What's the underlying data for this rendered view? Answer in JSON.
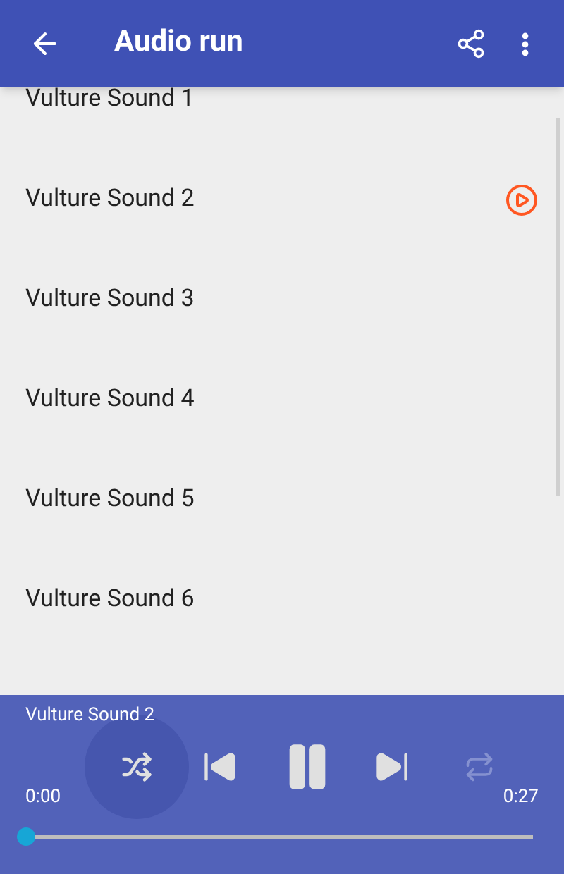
{
  "app_bar": {
    "title": "Audio run"
  },
  "tracks": [
    {
      "title": "Vulture Sound 1",
      "playing": false
    },
    {
      "title": "Vulture Sound 2",
      "playing": true
    },
    {
      "title": "Vulture Sound 3",
      "playing": false
    },
    {
      "title": "Vulture Sound 4",
      "playing": false
    },
    {
      "title": "Vulture Sound 5",
      "playing": false
    },
    {
      "title": "Vulture Sound 6",
      "playing": false
    }
  ],
  "player": {
    "title": "Vulture Sound 2",
    "elapsed": "0:00",
    "duration": "0:27",
    "shuffle_pressed": true,
    "playing": true,
    "repeat": false,
    "level": 0
  }
}
